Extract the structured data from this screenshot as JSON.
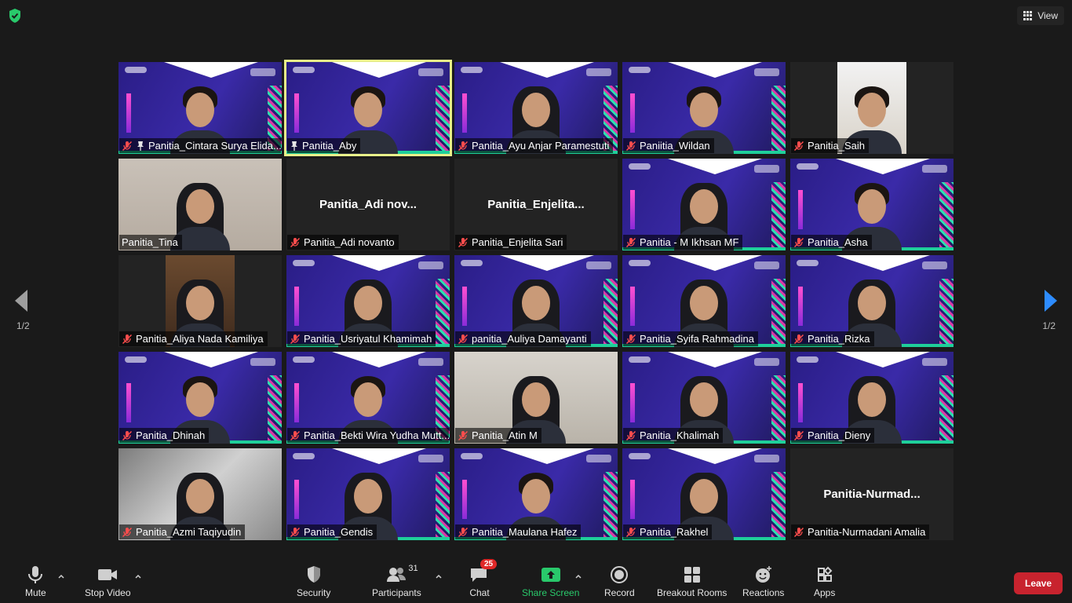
{
  "top": {
    "view_label": "View"
  },
  "colors": {
    "accent_green": "#29c96b",
    "leave_red": "#c8232e",
    "active_border": "#e8f08a"
  },
  "tiles": [
    {
      "name": "Panitia_Cintara Surya Elida...",
      "muted": true,
      "pinned": true,
      "bg": "virtual",
      "video": true
    },
    {
      "name": "Panitia_Aby",
      "muted": false,
      "pinned": true,
      "bg": "virtual",
      "video": true,
      "active": true
    },
    {
      "name": "Panitia_Ayu Anjar Paramestuti",
      "muted": true,
      "pinned": false,
      "bg": "virtual",
      "video": true
    },
    {
      "name": "Paniitia_Wildan",
      "muted": true,
      "pinned": false,
      "bg": "virtual",
      "video": true
    },
    {
      "name": "Panitia_Saih",
      "muted": true,
      "pinned": false,
      "bg": "portrait",
      "video": true
    },
    {
      "name": "Panitia_Tina",
      "muted": false,
      "pinned": false,
      "bg": "room",
      "video": true
    },
    {
      "name": "Panitia_Adi novanto",
      "muted": true,
      "pinned": false,
      "bg": "none",
      "video": false,
      "display_name": "Panitia_Adi  nov..."
    },
    {
      "name": "Panitia_Enjelita Sari",
      "muted": true,
      "pinned": false,
      "bg": "none",
      "video": false,
      "display_name": "Panitia_Enjelita..."
    },
    {
      "name": "Panitia - M Ikhsan MF",
      "muted": true,
      "pinned": false,
      "bg": "virtual",
      "video": true
    },
    {
      "name": "Panitia_Asha",
      "muted": true,
      "pinned": false,
      "bg": "virtual",
      "video": true
    },
    {
      "name": "Panitia_Aliya Nada Kamiliya",
      "muted": true,
      "pinned": false,
      "bg": "portrait-dark",
      "video": true
    },
    {
      "name": "Panitia_Usriyatul Khamimah",
      "muted": true,
      "pinned": false,
      "bg": "virtual",
      "video": true
    },
    {
      "name": "panitia_Auliya Damayanti",
      "muted": true,
      "pinned": false,
      "bg": "virtual",
      "video": true
    },
    {
      "name": "Panitia_Syifa Rahmadina",
      "muted": true,
      "pinned": false,
      "bg": "virtual",
      "video": true
    },
    {
      "name": "Panitia_Rizka",
      "muted": true,
      "pinned": false,
      "bg": "virtual",
      "video": true
    },
    {
      "name": "Panitia_Dhinah",
      "muted": true,
      "pinned": false,
      "bg": "virtual",
      "video": true
    },
    {
      "name": "Panitia_Bekti Wira Yudha Mutt...",
      "muted": true,
      "pinned": false,
      "bg": "virtual",
      "video": true
    },
    {
      "name": "Panitia_Atin M",
      "muted": true,
      "pinned": false,
      "bg": "room2",
      "video": true
    },
    {
      "name": "Panitia_Khalimah",
      "muted": true,
      "pinned": false,
      "bg": "virtual",
      "video": true
    },
    {
      "name": "Panitia_Dieny",
      "muted": true,
      "pinned": false,
      "bg": "virtual",
      "video": true
    },
    {
      "name": "Panitia_Azmi Taqiyudin",
      "muted": true,
      "pinned": false,
      "bg": "blur",
      "video": true
    },
    {
      "name": "Panitia_Gendis",
      "muted": true,
      "pinned": false,
      "bg": "virtual",
      "video": true
    },
    {
      "name": "Panitia_Maulana Hafez",
      "muted": true,
      "pinned": false,
      "bg": "virtual",
      "video": true
    },
    {
      "name": "Panitia_Rakhel",
      "muted": true,
      "pinned": false,
      "bg": "virtual",
      "video": true
    },
    {
      "name": "Panitia-Nurmadani Amalia",
      "muted": true,
      "pinned": false,
      "bg": "none",
      "video": false,
      "display_name": "Panitia-Nurmad..."
    }
  ],
  "pager": {
    "left": "1/2",
    "right": "1/2"
  },
  "toolbar": {
    "mute": "Mute",
    "stop_video": "Stop Video",
    "security": "Security",
    "participants": "Participants",
    "participants_count": "31",
    "chat": "Chat",
    "chat_badge": "25",
    "share_screen": "Share Screen",
    "record": "Record",
    "breakout_rooms": "Breakout Rooms",
    "reactions": "Reactions",
    "apps": "Apps",
    "leave": "Leave"
  }
}
